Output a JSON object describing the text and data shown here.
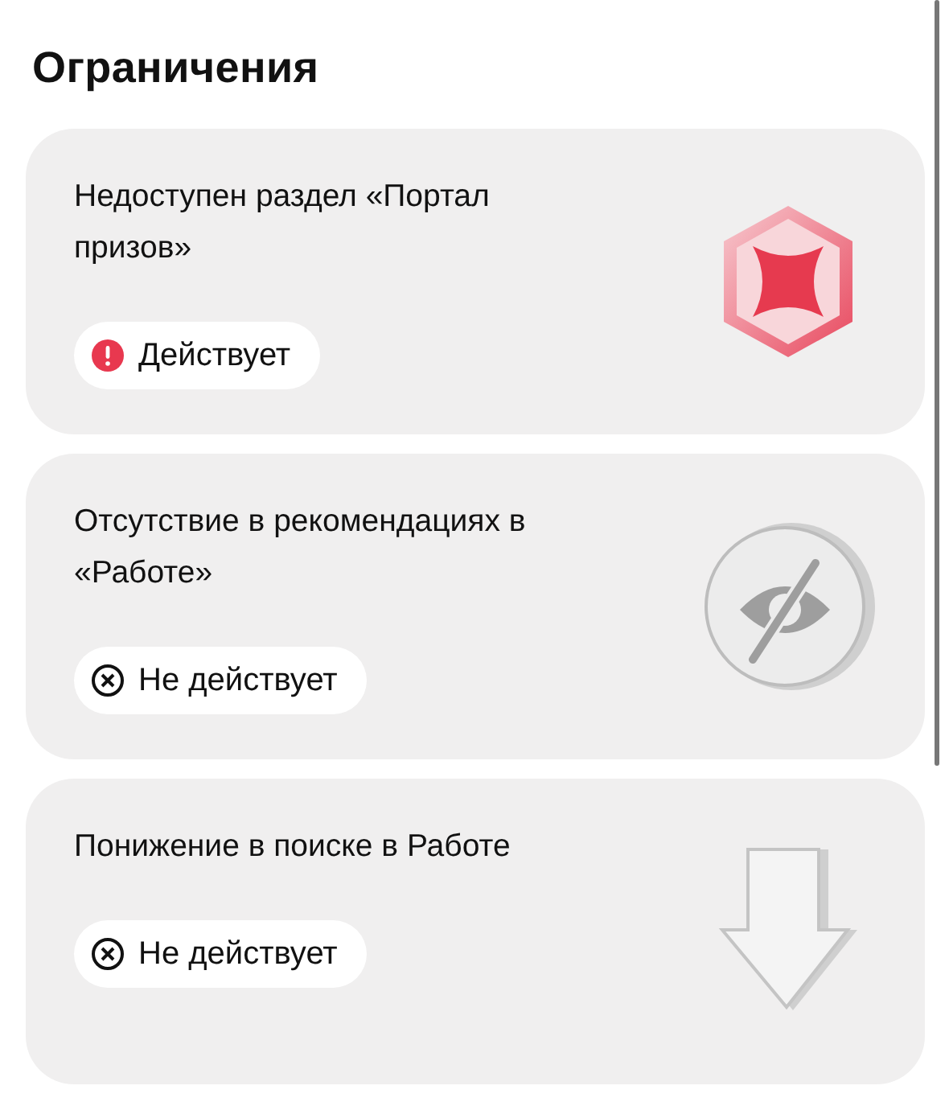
{
  "title": "Ограничения",
  "restrictions": [
    {
      "text": "Недоступен раздел «Портал призов»",
      "status": "Действует",
      "active": true,
      "kind": "star"
    },
    {
      "text": "Отсутствие в рекомендациях в «Работе»",
      "status": "Не действует",
      "active": false,
      "kind": "hidden"
    },
    {
      "text": "Понижение в поиске в Работе",
      "status": "Не действует",
      "active": false,
      "kind": "down"
    }
  ]
}
